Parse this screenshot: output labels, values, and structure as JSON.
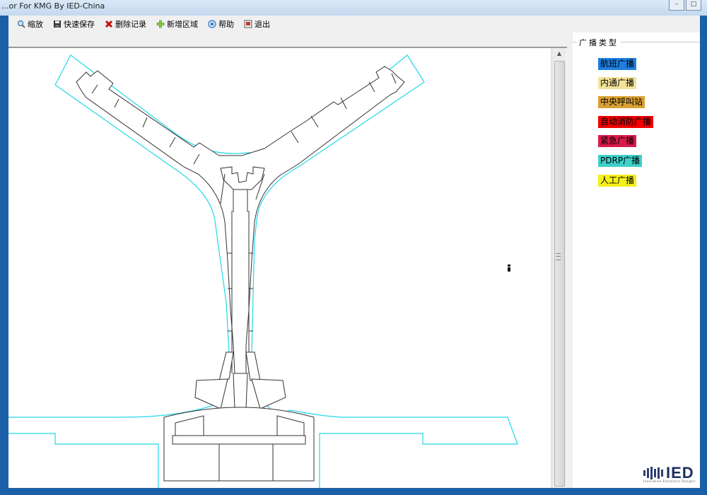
{
  "window": {
    "title": "...or For KMG By IED-China",
    "controls": [
      "minimize",
      "maximize"
    ]
  },
  "toolbar": {
    "items": [
      {
        "label": "缩放",
        "icon": "zoom-icon"
      },
      {
        "label": "快速保存",
        "icon": "save-icon"
      },
      {
        "label": "删除记录",
        "icon": "delete-icon"
      },
      {
        "label": "新增区域",
        "icon": "add-icon"
      },
      {
        "label": "帮助",
        "icon": "help-icon"
      },
      {
        "label": "退出",
        "icon": "exit-icon"
      }
    ]
  },
  "side": {
    "title": "广播类型",
    "legend": [
      {
        "label": "航班广播",
        "color": "#1e7fe0"
      },
      {
        "label": "内通广播",
        "color": "#f3e39a"
      },
      {
        "label": "中央呼叫站",
        "color": "#d9a032"
      },
      {
        "label": "自动消防广播",
        "color": "#f00000"
      },
      {
        "label": "紧急广播",
        "color": "#d81b4a"
      },
      {
        "label": "PDRP广播",
        "color": "#3fd0c8"
      },
      {
        "label": "人工广播",
        "color": "#f5ef1a"
      }
    ],
    "logo": {
      "text": "IED",
      "subtitle": "Innovative Electronic Designs"
    }
  },
  "colors": {
    "window_frame": "#1b5fa8",
    "outline_cyan": "#22d8e8",
    "building_stroke": "#333333"
  }
}
